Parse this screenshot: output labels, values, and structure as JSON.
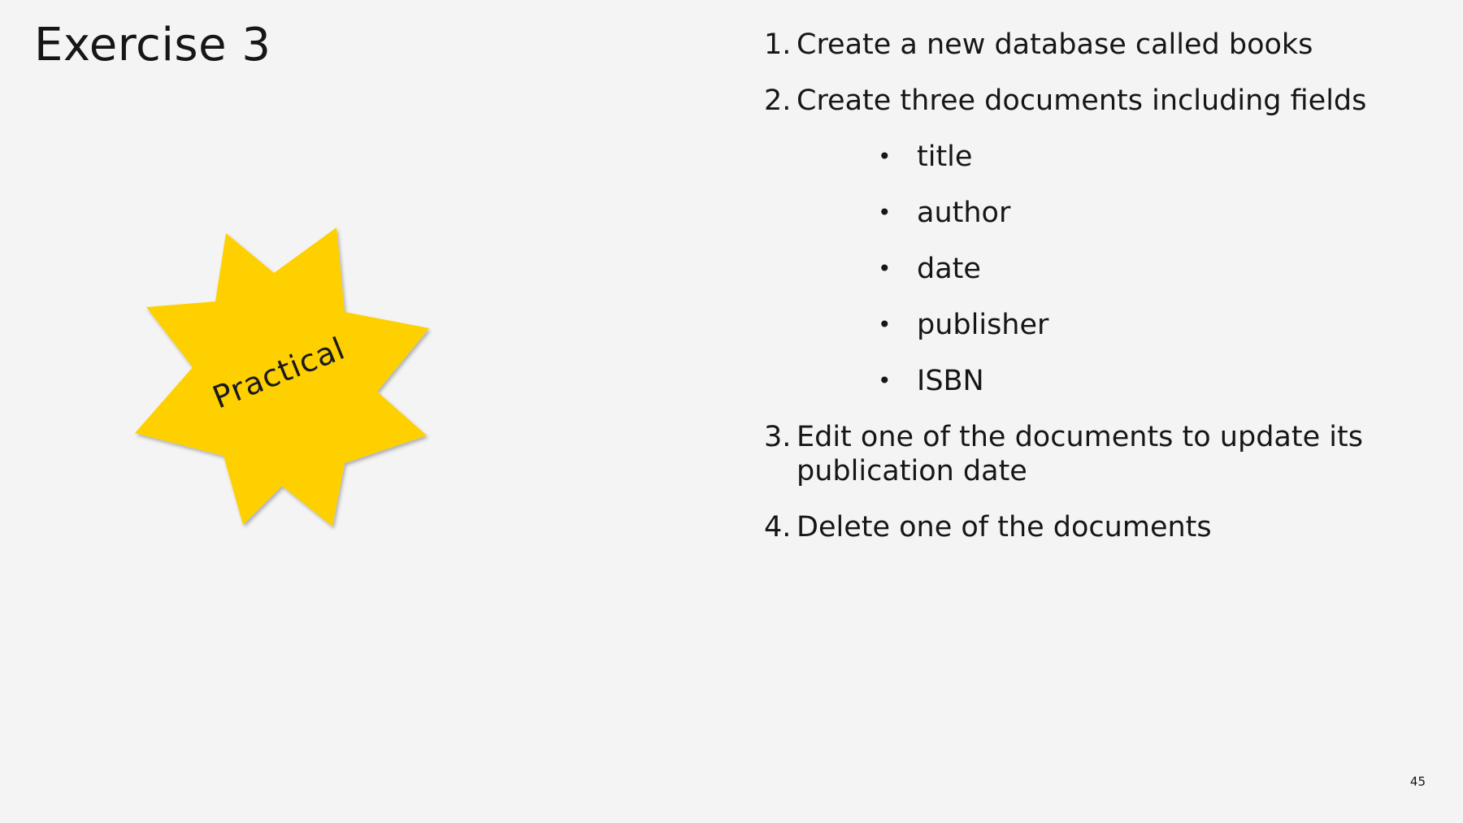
{
  "slide": {
    "title": "Exercise 3",
    "badge": {
      "label": "Practical",
      "fill_color": "#fed000",
      "shape": "eight-point-star"
    },
    "steps": [
      {
        "number": "1.",
        "text": "Create a new database called books"
      },
      {
        "number": "2.",
        "text": "Create three documents including fields"
      },
      {
        "number": "3.",
        "text": "Edit one of the documents to update its publication date"
      },
      {
        "number": "4.",
        "text": "Delete one of the documents"
      }
    ],
    "fields": [
      {
        "bullet": "•",
        "text": "title"
      },
      {
        "bullet": "•",
        "text": "author"
      },
      {
        "bullet": "•",
        "text": "date"
      },
      {
        "bullet": "•",
        "text": "publisher"
      },
      {
        "bullet": "•",
        "text": "ISBN"
      }
    ],
    "page_number": "45"
  }
}
